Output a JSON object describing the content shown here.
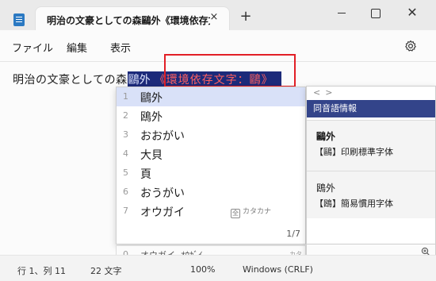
{
  "tab": {
    "title": "明治の文豪としての森鷗外《環境依存文",
    "close": "×",
    "new": "+"
  },
  "window": {
    "close": "✕"
  },
  "menu": {
    "file": "ファイル",
    "edit": "編集",
    "view": "表示"
  },
  "editor": {
    "text": "明治の文豪としての森",
    "composition_kanji": "鷗外",
    "composition_annotation": "《環境依存文字：鷗》"
  },
  "candidates": {
    "items": [
      {
        "num": "1",
        "text": "鷗外"
      },
      {
        "num": "2",
        "text": "鴎外"
      },
      {
        "num": "3",
        "text": "おおがい"
      },
      {
        "num": "4",
        "text": "大貝"
      },
      {
        "num": "5",
        "text": "頁"
      },
      {
        "num": "6",
        "text": "おうがい"
      },
      {
        "num": "7",
        "text": "オウガイ",
        "hint_icon": "全",
        "hint": "カタカナ"
      }
    ],
    "page": "1/7",
    "footer": {
      "num": "0",
      "text": "オウガイ, ｵｳｶﾞｲ…",
      "right": "カタ"
    }
  },
  "info_panel": {
    "nav_prev": "<",
    "nav_next": ">",
    "header": "同音語情報",
    "sections": [
      {
        "title": "鷗外",
        "desc": "【鷗】印刷標準字体"
      },
      {
        "title": "鴎外",
        "desc": "【鴎】簡易慣用字体"
      }
    ]
  },
  "status": {
    "position": "行 1、列 11",
    "chars": "22 文字",
    "zoom": "100%",
    "eol": "Windows (CRLF)"
  },
  "colors": {
    "composition_bg": "#1c2a7a",
    "annotation_text": "#ff6060",
    "highlight_box": "#e21f26",
    "info_header_bg": "#33448a",
    "selected_candidate_bg": "#d9e1f8"
  }
}
